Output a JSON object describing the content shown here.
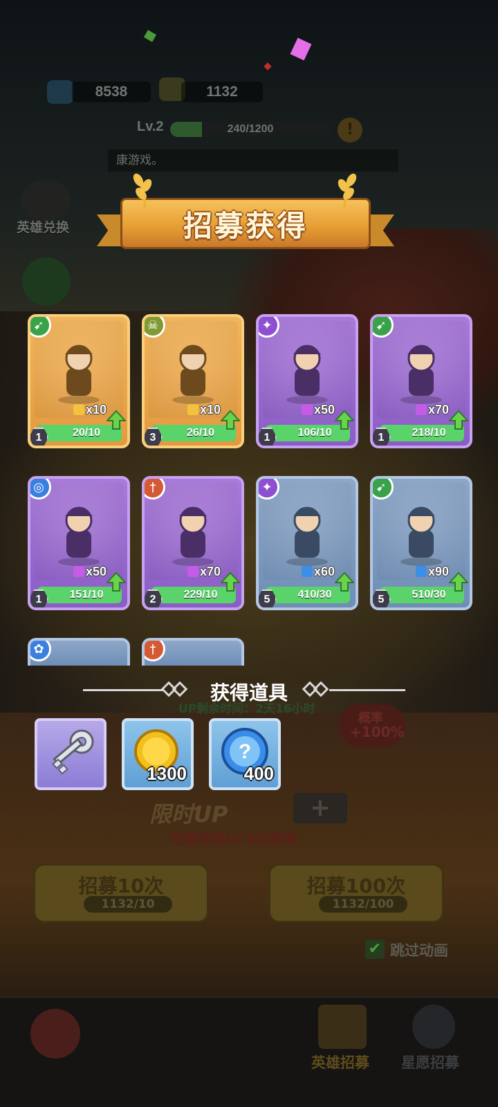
{
  "header": {
    "gems": "8538",
    "tickets": "1132",
    "level": "Lv.2",
    "xp": "240/1200",
    "xp_progress": 0.2,
    "notice": "康游戏。"
  },
  "side": {
    "hero_exchange": "英雄兑换"
  },
  "banner": {
    "title": "招募获得"
  },
  "heroes": [
    {
      "rarity": "gold",
      "class": "archer",
      "class_color": "#3aa34a",
      "frag_color": "#f4c23e",
      "count": "x10",
      "level": "1",
      "progress": "20/10",
      "fill": 1.0
    },
    {
      "rarity": "gold",
      "class": "skull",
      "class_color": "#7f9a33",
      "frag_color": "#f4c23e",
      "count": "x10",
      "level": "3",
      "progress": "26/10",
      "fill": 1.0
    },
    {
      "rarity": "purple",
      "class": "mage",
      "class_color": "#8e4fd0",
      "frag_color": "#c55ce8",
      "count": "x50",
      "level": "1",
      "progress": "106/10",
      "fill": 1.0
    },
    {
      "rarity": "purple",
      "class": "archer",
      "class_color": "#3aa34a",
      "frag_color": "#c55ce8",
      "count": "x70",
      "level": "1",
      "progress": "218/10",
      "fill": 1.0
    },
    {
      "rarity": "purple",
      "class": "spiral",
      "class_color": "#3b7fe0",
      "frag_color": "#c55ce8",
      "count": "x50",
      "level": "1",
      "progress": "151/10",
      "fill": 1.0
    },
    {
      "rarity": "purple",
      "class": "sword",
      "class_color": "#d35a34",
      "frag_color": "#c55ce8",
      "count": "x70",
      "level": "2",
      "progress": "229/10",
      "fill": 1.0
    },
    {
      "rarity": "blue",
      "class": "mage",
      "class_color": "#8e4fd0",
      "frag_color": "#3b8fe8",
      "count": "x60",
      "level": "5",
      "progress": "410/30",
      "fill": 1.0
    },
    {
      "rarity": "blue",
      "class": "archer",
      "class_color": "#3aa34a",
      "frag_color": "#3b8fe8",
      "count": "x90",
      "level": "5",
      "progress": "510/30",
      "fill": 1.0
    }
  ],
  "partial_cards": [
    {
      "class": "paw",
      "class_color": "#3b7fe0"
    },
    {
      "class": "sword",
      "class_color": "#d35a34"
    }
  ],
  "items": {
    "title": "获得道具",
    "list": [
      {
        "name": "key",
        "qty": ""
      },
      {
        "name": "gold-coin",
        "qty": "1300"
      },
      {
        "name": "mystery-orb",
        "qty": "400"
      }
    ]
  },
  "background_ui": {
    "up_time": "UP剩余时间：2天16小时",
    "rate": "概率",
    "rate_value": "+100%",
    "limited_up": "限时UP",
    "unlock_hint": "招募等级LV.4后解锁",
    "recruit_10": "招募10次",
    "recruit_10_cost": "1132/10",
    "recruit_100": "招募100次",
    "recruit_100_cost": "1132/100",
    "skip_animation": "跳过动画",
    "tab_hero_recruit": "英雄招募",
    "tab_star_recruit": "星愿招募"
  }
}
